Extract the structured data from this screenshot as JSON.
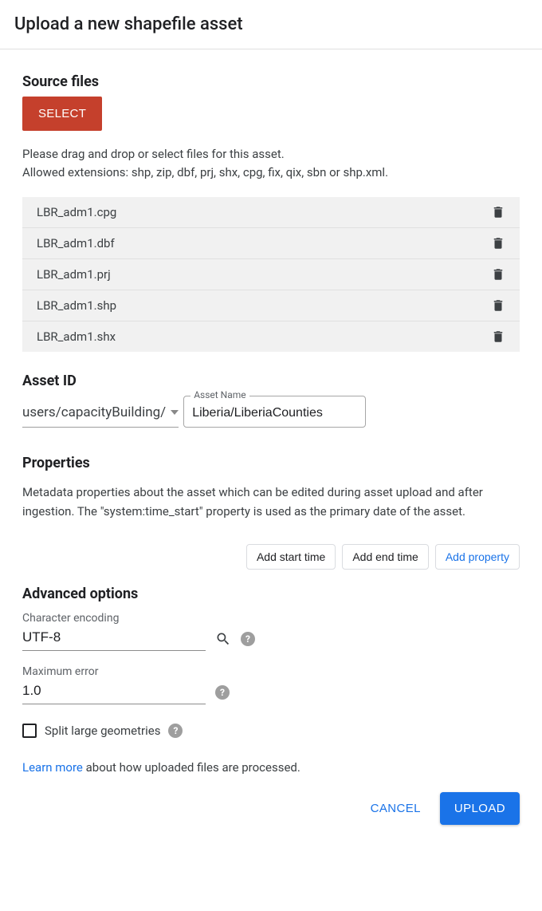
{
  "dialog": {
    "title": "Upload a new shapefile asset"
  },
  "source": {
    "heading": "Source files",
    "selectLabel": "SELECT",
    "hint1": "Please drag and drop or select files for this asset.",
    "hint2": "Allowed extensions: shp, zip, dbf, prj, shx, cpg, fix, qix, sbn or shp.xml.",
    "files": [
      {
        "name": "LBR_adm1.cpg"
      },
      {
        "name": "LBR_adm1.dbf"
      },
      {
        "name": "LBR_adm1.prj"
      },
      {
        "name": "LBR_adm1.shp"
      },
      {
        "name": "LBR_adm1.shx"
      }
    ]
  },
  "assetId": {
    "heading": "Asset ID",
    "pathPrefix": "users/capacityBuilding/",
    "boxLabel": "Asset Name",
    "value": "Liberia/LiberiaCounties"
  },
  "properties": {
    "heading": "Properties",
    "body": "Metadata properties about the asset which can be edited during asset upload and after ingestion. The \"system:time_start\" property is used as the primary date of the asset.",
    "buttons": {
      "addStart": "Add start time",
      "addEnd": "Add end time",
      "addProp": "Add property"
    }
  },
  "advanced": {
    "heading": "Advanced options",
    "encodingLabel": "Character encoding",
    "encodingValue": "UTF-8",
    "maxErrorLabel": "Maximum error",
    "maxErrorValue": "1.0",
    "splitLabel": "Split large geometries"
  },
  "footer": {
    "learnMore": "Learn more",
    "learnMoreRest": " about how uploaded files are processed.",
    "cancel": "CANCEL",
    "upload": "UPLOAD"
  }
}
